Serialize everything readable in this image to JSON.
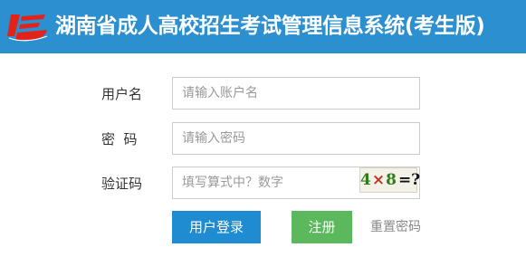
{
  "header": {
    "title": "湖南省成人高校招生考试管理信息系统(考生版)",
    "logo_icon": "ks-logo-icon",
    "background": "#2b8fd0"
  },
  "form": {
    "username_label": "用户名",
    "username_placeholder": "请输入账户名",
    "password_label": "密  码",
    "password_placeholder": "请输入密码",
    "captcha_label": "验证码",
    "captcha_placeholder": "填写算式中？数字",
    "captcha": {
      "operand1": "4",
      "operator": "×",
      "operand2": "8",
      "suffix": "=?"
    }
  },
  "actions": {
    "login_label": "用户登录",
    "register_label": "注册",
    "reset_label": "重置密码"
  },
  "colors": {
    "header": "#2b8fd0",
    "login_button": "#1f8bd0",
    "register_button": "#5cb85c"
  }
}
